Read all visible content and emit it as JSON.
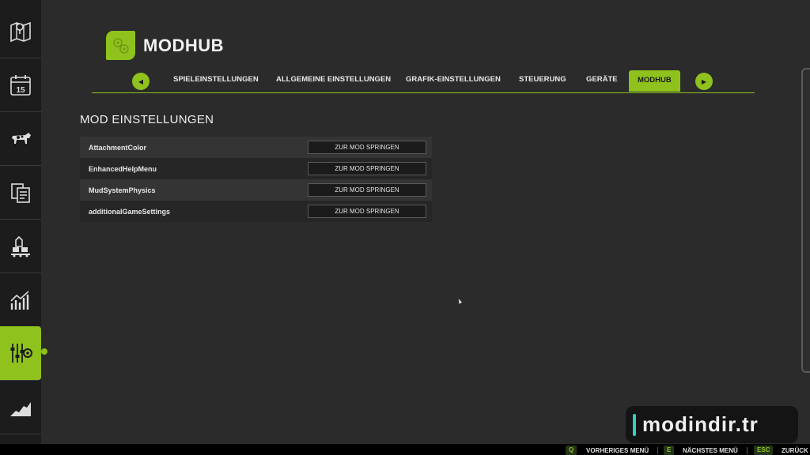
{
  "header": {
    "title": "MODHUB",
    "logo_icon": "modhub-logo-icon",
    "accent_color": "#8fc21d"
  },
  "sidebar": {
    "items": [
      {
        "icon": "map-icon",
        "active": false
      },
      {
        "icon": "calendar-icon",
        "day": "15",
        "active": false
      },
      {
        "icon": "cow-icon",
        "active": false
      },
      {
        "icon": "contracts-icon",
        "active": false
      },
      {
        "icon": "production-icon",
        "active": false
      },
      {
        "icon": "statistics-icon",
        "active": false
      },
      {
        "icon": "settings-sliders-icon",
        "active": true
      },
      {
        "icon": "terrain-icon",
        "active": false
      }
    ]
  },
  "tabs": {
    "prev_icon": "chevron-left-icon",
    "next_icon": "chevron-right-icon",
    "items": [
      {
        "label": "SPIELEINSTELLUNGEN",
        "active": false
      },
      {
        "label": "ALLGEMEINE EINSTELLUNGEN",
        "active": false
      },
      {
        "label": "GRAFIK-EINSTELLUNGEN",
        "active": false
      },
      {
        "label": "STEUERUNG",
        "active": false
      },
      {
        "label": "GERÄTE",
        "active": false
      },
      {
        "label": "MODHUB",
        "active": true
      }
    ]
  },
  "section": {
    "title": "MOD EINSTELLUNGEN",
    "rows": [
      {
        "name": "AttachmentColor",
        "button": "ZUR MOD SPRINGEN"
      },
      {
        "name": "EnhancedHelpMenu",
        "button": "ZUR MOD SPRINGEN"
      },
      {
        "name": "MudSystemPhysics",
        "button": "ZUR MOD SPRINGEN"
      },
      {
        "name": "additionalGameSettings",
        "button": "ZUR MOD SPRINGEN"
      }
    ]
  },
  "watermark": {
    "text": "modindir.tr"
  },
  "bottom_hints": [
    {
      "key": "Q",
      "label": "VORHERIGES MENÜ"
    },
    {
      "key": "E",
      "label": "NÄCHSTES MENÜ"
    },
    {
      "key": "ESC",
      "label": "ZURÜCK"
    }
  ]
}
